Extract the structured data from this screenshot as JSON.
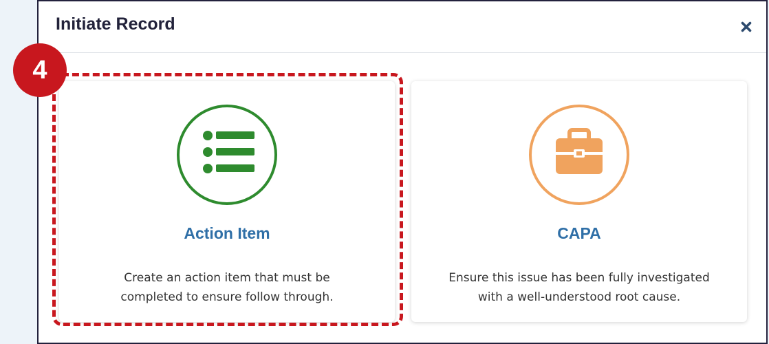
{
  "modal": {
    "title": "Initiate Record",
    "close_icon": "close-icon"
  },
  "cards": [
    {
      "title": "Action Item",
      "description_lines": [
        "Create an action item that must be",
        "completed to ensure follow through."
      ],
      "icon": "list-icon",
      "accent_color": "#2e8b2e"
    },
    {
      "title": "CAPA",
      "description_lines": [
        "Ensure this issue has been fully investigated",
        "with a well-understood root cause."
      ],
      "icon": "briefcase-icon",
      "accent_color": "#f0a35e"
    }
  ],
  "annotation": {
    "step_number": "4",
    "color": "#c8171e"
  }
}
